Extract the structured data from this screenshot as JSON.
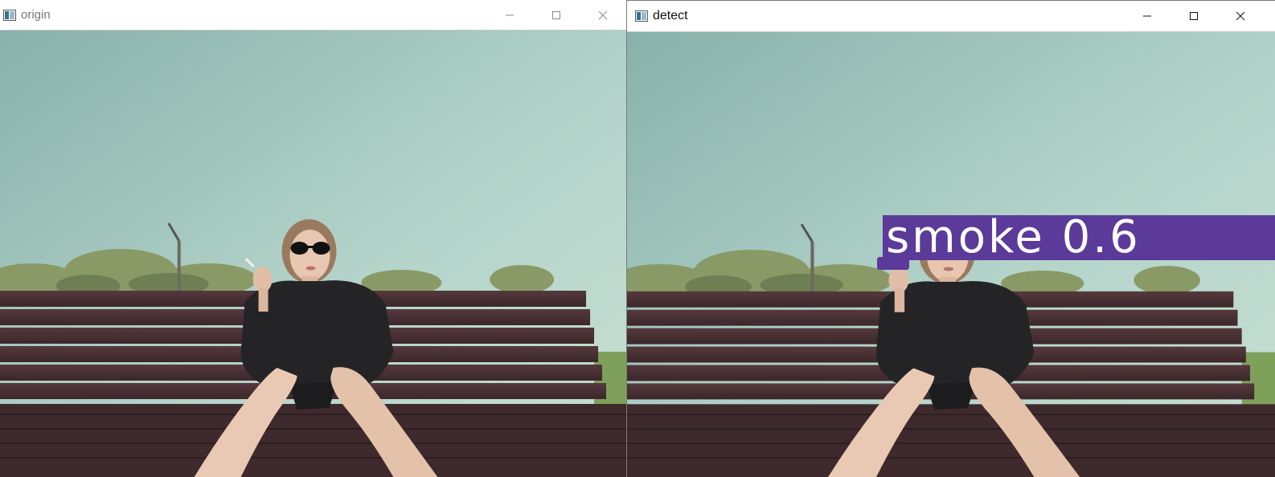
{
  "windows": {
    "origin": {
      "title": "origin"
    },
    "detect": {
      "title": "detect",
      "detection": {
        "label": "smoke 0.6"
      }
    }
  },
  "icons": [
    "app-icon",
    "minimize-icon",
    "maximize-icon",
    "close-icon"
  ],
  "colors": {
    "label_bg": "#5b3a9a",
    "sky": "#a9ccc4",
    "bench": "#4a3236"
  }
}
